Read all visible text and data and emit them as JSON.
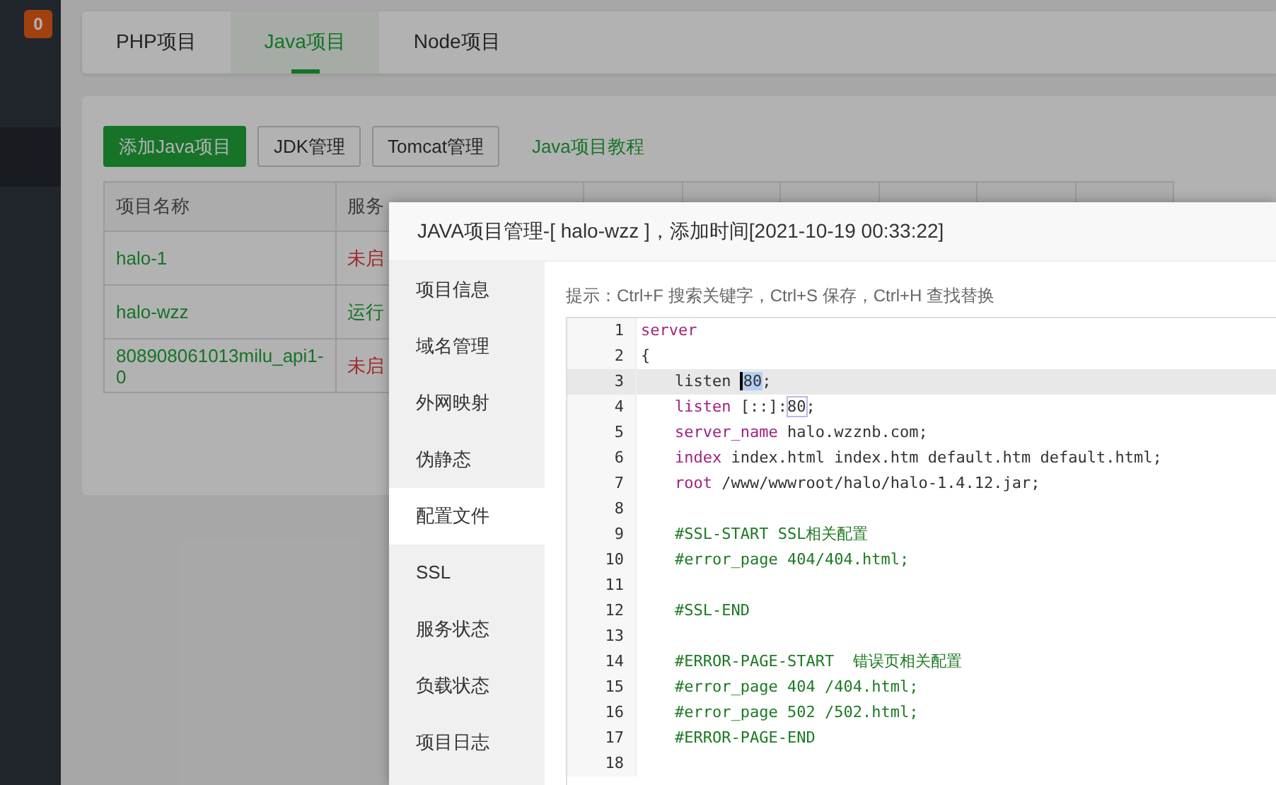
{
  "sidebar": {
    "badge": "0"
  },
  "tabs": [
    {
      "label": "PHP项目",
      "selected": false
    },
    {
      "label": "Java项目",
      "selected": true
    },
    {
      "label": "Node项目",
      "selected": false
    }
  ],
  "toolbar": [
    {
      "label": "添加Java项目",
      "kind": "primary"
    },
    {
      "label": "JDK管理",
      "kind": "default"
    },
    {
      "label": "Tomcat管理",
      "kind": "default"
    },
    {
      "label": "Java项目教程",
      "kind": "link"
    }
  ],
  "table": {
    "columns": [
      "项目名称",
      "服务"
    ],
    "rows": [
      {
        "name": "halo-1",
        "status": "未启",
        "running": false
      },
      {
        "name": "halo-wzz",
        "status": "运行",
        "running": true
      },
      {
        "name": "808908061013milu_api1-0",
        "status": "未启",
        "running": false
      }
    ]
  },
  "modal": {
    "title": "JAVA项目管理-[ halo-wzz ]，添加时间[2021-10-19 00:33:22]",
    "menu": [
      {
        "label": "项目信息",
        "selected": false
      },
      {
        "label": "域名管理",
        "selected": false
      },
      {
        "label": "外网映射",
        "selected": false
      },
      {
        "label": "伪静态",
        "selected": false
      },
      {
        "label": "配置文件",
        "selected": true
      },
      {
        "label": "SSL",
        "selected": false
      },
      {
        "label": "服务状态",
        "selected": false
      },
      {
        "label": "负载状态",
        "selected": false
      },
      {
        "label": "项目日志",
        "selected": false
      }
    ],
    "hint": "提示：Ctrl+F 搜索关键字，Ctrl+S 保存，Ctrl+H 查找替换",
    "editor": {
      "lines": [
        {
          "number": "1",
          "current": false,
          "indented": false,
          "tokens": [
            {
              "text": "server",
              "kind": "keyword"
            }
          ]
        },
        {
          "number": "2",
          "current": false,
          "indented": false,
          "tokens": [
            {
              "text": "{",
              "kind": "plain"
            }
          ]
        },
        {
          "number": "3",
          "current": true,
          "indented": true,
          "tokens": [
            {
              "text": "listen ",
              "kind": "plain"
            },
            {
              "text": "80",
              "kind": "selection"
            },
            {
              "text": ";",
              "kind": "plain"
            }
          ]
        },
        {
          "number": "4",
          "current": false,
          "indented": true,
          "tokens": [
            {
              "text": "listen",
              "kind": "keyword"
            },
            {
              "text": " [::]:",
              "kind": "plain"
            },
            {
              "text": "80",
              "kind": "match"
            },
            {
              "text": ";",
              "kind": "plain"
            }
          ]
        },
        {
          "number": "5",
          "current": false,
          "indented": true,
          "tokens": [
            {
              "text": "server_name",
              "kind": "keyword"
            },
            {
              "text": " halo.wzznb.com;",
              "kind": "plain"
            }
          ]
        },
        {
          "number": "6",
          "current": false,
          "indented": true,
          "tokens": [
            {
              "text": "index",
              "kind": "keyword"
            },
            {
              "text": " index.html index.htm default.htm default.html;",
              "kind": "plain"
            }
          ]
        },
        {
          "number": "7",
          "current": false,
          "indented": true,
          "tokens": [
            {
              "text": "root",
              "kind": "keyword"
            },
            {
              "text": " /www/wwwroot/halo/halo-1.4.12.jar;",
              "kind": "plain"
            }
          ]
        },
        {
          "number": "8",
          "current": false,
          "indented": false
        },
        {
          "number": "9",
          "current": false,
          "indented": true,
          "tokens": [
            {
              "text": "#SSL-START SSL相关配置",
              "kind": "comment"
            }
          ]
        },
        {
          "number": "10",
          "current": false,
          "indented": true,
          "tokens": [
            {
              "text": "#error_page 404/404.html;",
              "kind": "comment"
            }
          ]
        },
        {
          "number": "11",
          "current": false,
          "indented": false
        },
        {
          "number": "12",
          "current": false,
          "indented": true,
          "tokens": [
            {
              "text": "#SSL-END",
              "kind": "comment"
            }
          ]
        },
        {
          "number": "13",
          "current": false,
          "indented": false
        },
        {
          "number": "14",
          "current": false,
          "indented": true,
          "tokens": [
            {
              "text": "#ERROR-PAGE-START  错误页相关配置",
              "kind": "comment"
            }
          ]
        },
        {
          "number": "15",
          "current": false,
          "indented": true,
          "tokens": [
            {
              "text": "#error_page 404 /404.html;",
              "kind": "comment"
            }
          ]
        },
        {
          "number": "16",
          "current": false,
          "indented": true,
          "tokens": [
            {
              "text": "#error_page 502 /502.html;",
              "kind": "comment"
            }
          ]
        },
        {
          "number": "17",
          "current": false,
          "indented": true,
          "tokens": [
            {
              "text": "#ERROR-PAGE-END",
              "kind": "comment"
            }
          ]
        },
        {
          "number": "18",
          "current": false,
          "indented": false
        }
      ]
    }
  }
}
